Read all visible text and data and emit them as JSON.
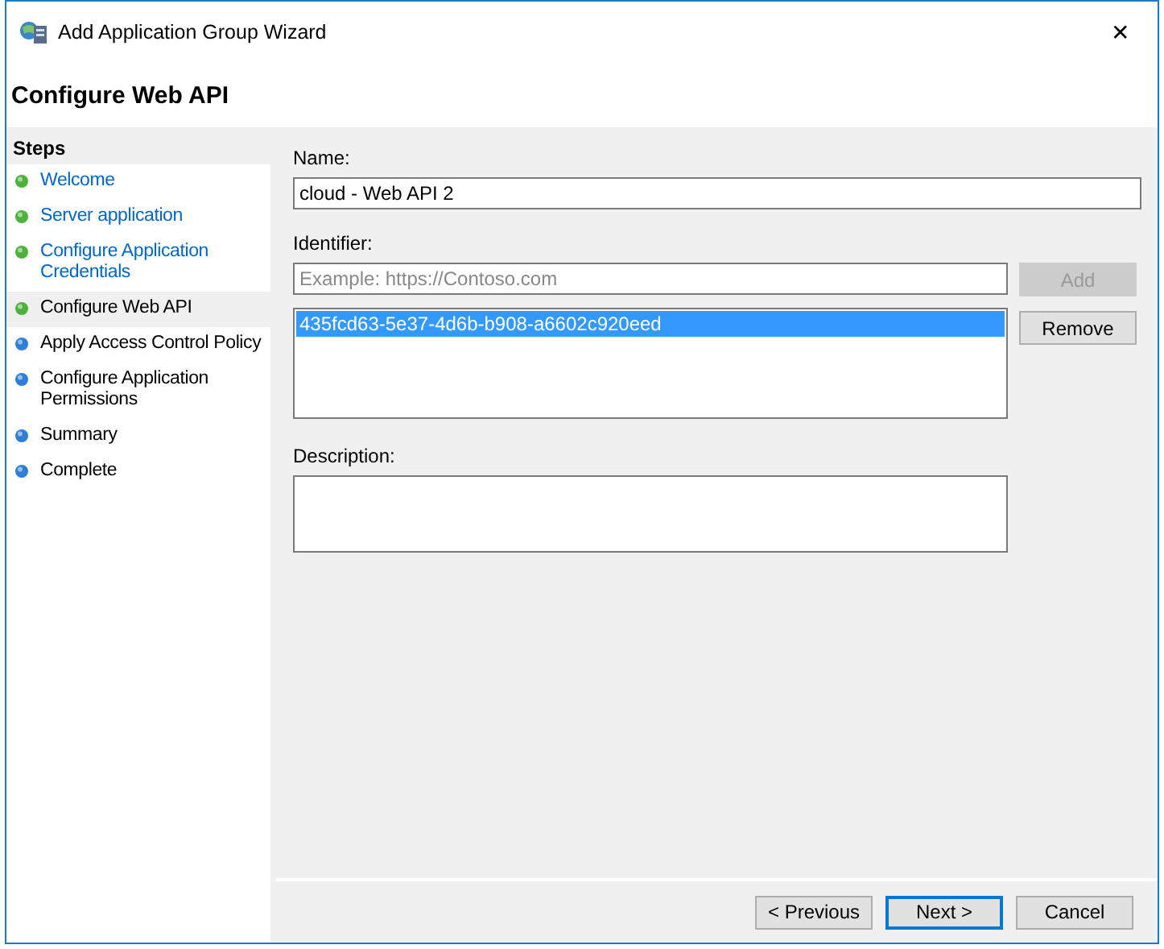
{
  "window": {
    "title": "Add Application Group Wizard",
    "close": "✕"
  },
  "page_title": "Configure Web API",
  "steps": {
    "heading": "Steps",
    "items": [
      {
        "label": "Welcome",
        "done": true,
        "selected": false
      },
      {
        "label": "Server application",
        "done": true,
        "selected": false
      },
      {
        "label": "Configure Application Credentials",
        "done": true,
        "selected": false
      },
      {
        "label": "Configure Web API",
        "done": true,
        "selected": true
      },
      {
        "label": "Apply Access Control Policy",
        "done": false,
        "selected": false
      },
      {
        "label": "Configure Application Permissions",
        "done": false,
        "selected": false
      },
      {
        "label": "Summary",
        "done": false,
        "selected": false
      },
      {
        "label": "Complete",
        "done": false,
        "selected": false
      }
    ]
  },
  "form": {
    "name_label": "Name:",
    "name_value": "cloud - Web API 2",
    "identifier_label": "Identifier:",
    "identifier_placeholder": "Example: https://Contoso.com",
    "add_button": {
      "label": "Add",
      "disabled": true
    },
    "identifiers": [
      {
        "text": "435fcd63-5e37-4d6b-b908-a6602c920eed",
        "selected": true
      }
    ],
    "remove_button": {
      "label": "Remove",
      "disabled": false
    },
    "description_label": "Description:"
  },
  "buttons": [
    {
      "label": "< Previous",
      "default": false
    },
    {
      "label": "Next >",
      "default": true
    },
    {
      "label": "Cancel",
      "default": false
    }
  ]
}
